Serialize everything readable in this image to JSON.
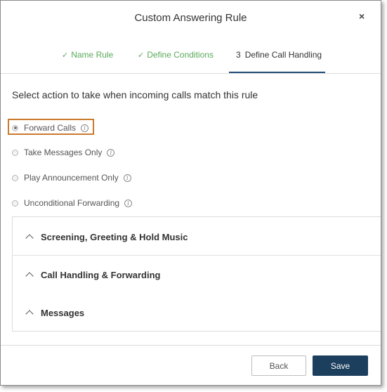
{
  "dialog": {
    "title": "Custom Answering Rule",
    "close_label": "×"
  },
  "steps": [
    {
      "check": "✓",
      "label": "Name Rule",
      "status": "done"
    },
    {
      "check": "✓",
      "label": "Define Conditions",
      "status": "done"
    },
    {
      "number": "3",
      "label": "Define Call Handling",
      "status": "active"
    }
  ],
  "instruction": "Select action to take when incoming calls match this rule",
  "options": [
    {
      "label": "Forward Calls",
      "selected": true
    },
    {
      "label": "Take Messages Only",
      "selected": false
    },
    {
      "label": "Play Announcement Only",
      "selected": false
    },
    {
      "label": "Unconditional Forwarding",
      "selected": false
    }
  ],
  "info_glyph": "i",
  "sections": [
    {
      "label": "Screening, Greeting & Hold Music"
    },
    {
      "label": "Call Handling & Forwarding"
    },
    {
      "label": "Messages"
    }
  ],
  "buttons": {
    "back": "Back",
    "save": "Save"
  },
  "colors": {
    "done_step": "#5aa95a",
    "active_underline": "#1e4b73",
    "highlight_border": "#c97a2c",
    "save_button": "#1c3f5e"
  }
}
